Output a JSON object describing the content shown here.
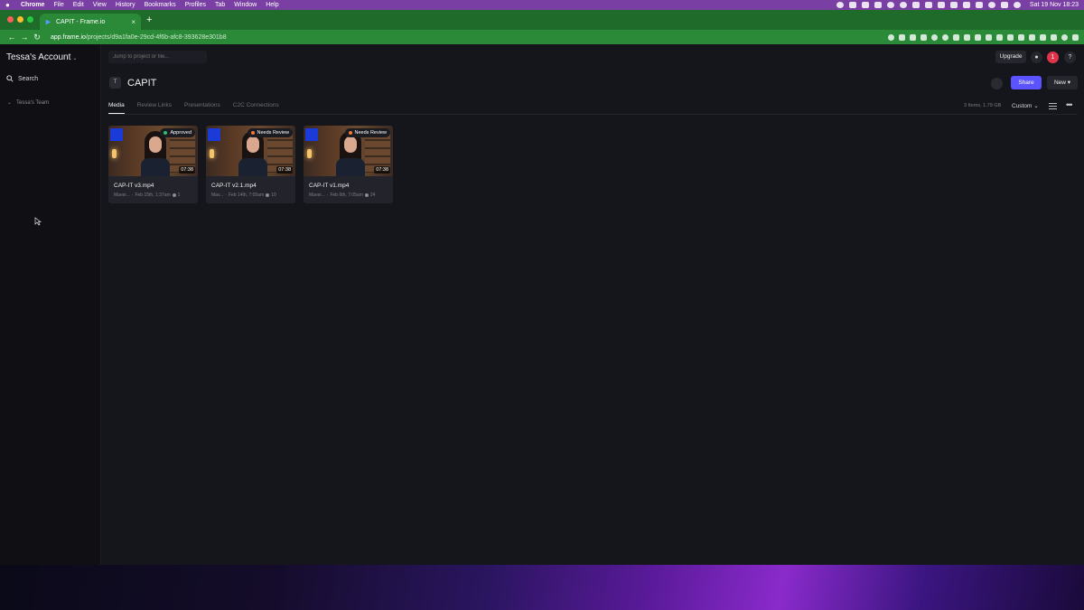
{
  "menubar": {
    "items": [
      "Chrome",
      "File",
      "Edit",
      "View",
      "History",
      "Bookmarks",
      "Profiles",
      "Tab",
      "Window",
      "Help"
    ],
    "clock": "Sat 19 Nov  18:23"
  },
  "browser": {
    "tab_title": "CAPIT - Frame.io",
    "url_host": "app.frame.io",
    "url_path": "/projects/d9a1fa0e-29cd-4f6b-afc8-393628e301b8"
  },
  "sidebar": {
    "account": "Tessa's Account",
    "search_label": "Search",
    "team_label": "Tessa's Team"
  },
  "header": {
    "jump_placeholder": "Jump to project or file...",
    "upgrade_label": "Upgrade",
    "notification_count": "1",
    "help_label": "?"
  },
  "project": {
    "badge": "T",
    "title": "CAPIT",
    "share_label": "Share",
    "new_label": "New"
  },
  "tabs": [
    "Media",
    "Review Links",
    "Presentations",
    "C2C Connections"
  ],
  "toolbar": {
    "meta": "3 Items, 1.79 GB",
    "sort_label": "Custom"
  },
  "assets": [
    {
      "name": "CAP-IT v3.mp4",
      "owner": "Maver...",
      "date": "Feb 15th, 1:37am",
      "comments": "1",
      "status": "Approved",
      "status_color": "#2fbf71",
      "duration": "07:38"
    },
    {
      "name": "CAP-IT v2.1.mp4",
      "owner": "Mav...",
      "date": "Feb 14th, 7:05am",
      "comments": "10",
      "status": "Needs Review",
      "status_color": "#f27a3a",
      "duration": "07:38"
    },
    {
      "name": "CAP-IT v1.mp4",
      "owner": "Maver...",
      "date": "Feb 6th, 7:05am",
      "comments": "24",
      "status": "Needs Review",
      "status_color": "#f27a3a",
      "duration": "07:38"
    }
  ]
}
